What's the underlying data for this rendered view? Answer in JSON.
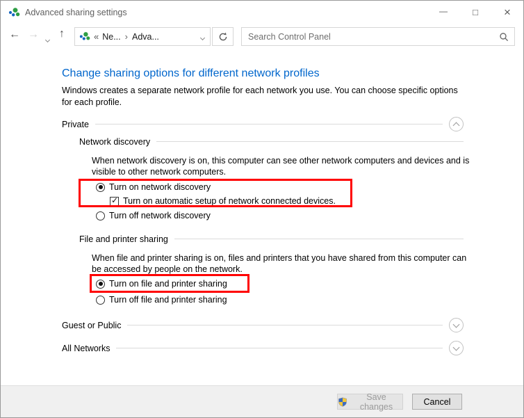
{
  "window": {
    "title": "Advanced sharing settings",
    "minimize_glyph": "—",
    "maximize_glyph": "□",
    "close_glyph": "×"
  },
  "nav": {
    "back_glyph": "←",
    "forward_glyph": "→",
    "up_glyph": "↑",
    "breadcrumb": {
      "overflow_glyph": "«",
      "crumb_network": "Ne...",
      "separator_glyph": "›",
      "crumb_advanced": "Adva..."
    },
    "search": {
      "placeholder": "Search Control Panel"
    }
  },
  "page": {
    "heading": "Change sharing options for different network profiles",
    "intro": "Windows creates a separate network profile for each network you use. You can choose specific options for each profile."
  },
  "profiles": {
    "private": {
      "label": "Private",
      "expanded": true,
      "network_discovery": {
        "title": "Network discovery",
        "description": "When network discovery is on, this computer can see other network computers and devices and is visible to other network computers.",
        "turn_on": {
          "label": "Turn on network discovery",
          "checked": true
        },
        "auto_setup": {
          "label": "Turn on automatic setup of network connected devices.",
          "checked": true
        },
        "turn_off": {
          "label": "Turn off network discovery",
          "checked": false
        }
      },
      "file_printer_sharing": {
        "title": "File and printer sharing",
        "description": "When file and printer sharing is on, files and printers that you have shared from this computer can be accessed by people on the network.",
        "turn_on": {
          "label": "Turn on file and printer sharing",
          "checked": true
        },
        "turn_off": {
          "label": "Turn off file and printer sharing",
          "checked": false
        }
      }
    },
    "guest_or_public": {
      "label": "Guest or Public",
      "expanded": false
    },
    "all_networks": {
      "label": "All Networks",
      "expanded": false
    }
  },
  "footer": {
    "save": {
      "label": "Save changes",
      "disabled": true
    },
    "cancel": {
      "label": "Cancel"
    }
  },
  "annotations": {
    "highlight_color": "#ff0000",
    "highlight_1_target": "turn-on-network-discovery-with-auto-setup",
    "highlight_2_target": "turn-on-file-and-printer-sharing"
  }
}
